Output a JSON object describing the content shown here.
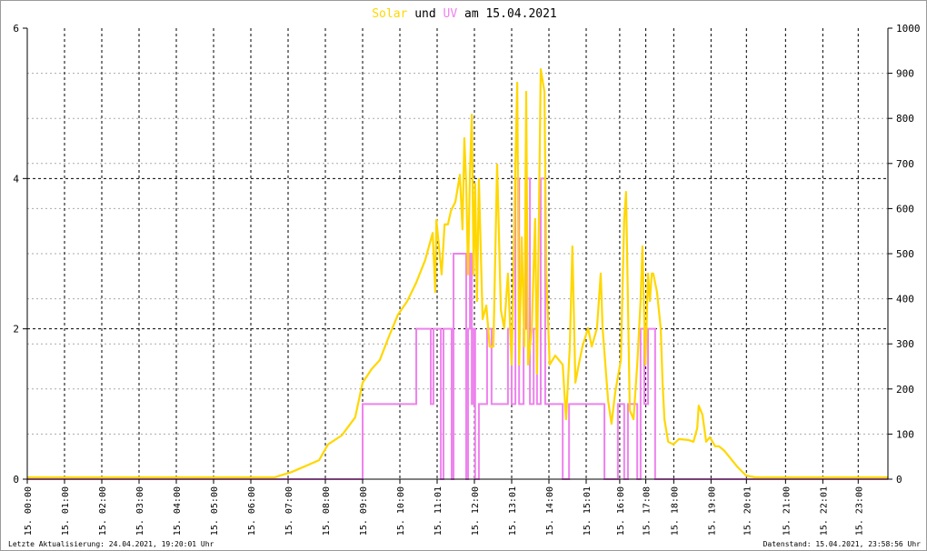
{
  "chart_data": {
    "type": "line",
    "title_parts": {
      "solar": "Solar",
      "und": "und",
      "uv": "UV",
      "date": "am 15.04.2021"
    },
    "left_axis": {
      "label": "UV",
      "ylim": [
        0,
        6
      ],
      "ticks": [
        "0",
        "2",
        "4",
        "6"
      ]
    },
    "right_axis": {
      "label": "Solar",
      "ylim": [
        0,
        1000
      ],
      "ticks": [
        "0",
        "100",
        "200",
        "300",
        "400",
        "500",
        "600",
        "700",
        "800",
        "900",
        "1000"
      ]
    },
    "x_ticks": [
      {
        "x": 0,
        "label": "15. 00:00"
      },
      {
        "x": 1,
        "label": "15. 01:00"
      },
      {
        "x": 2,
        "label": "15. 02:00"
      },
      {
        "x": 3,
        "label": "15. 03:00"
      },
      {
        "x": 4,
        "label": "15. 04:00"
      },
      {
        "x": 5,
        "label": "15. 05:00"
      },
      {
        "x": 6,
        "label": "15. 06:00"
      },
      {
        "x": 7,
        "label": "15. 07:00"
      },
      {
        "x": 8,
        "label": "15. 08:00"
      },
      {
        "x": 9,
        "label": "15. 09:00"
      },
      {
        "x": 10,
        "label": "15. 10:00"
      },
      {
        "x": 11,
        "label": "15. 11:01"
      },
      {
        "x": 12,
        "label": "15. 12:00"
      },
      {
        "x": 13,
        "label": "15. 13:01"
      },
      {
        "x": 14,
        "label": "15. 14:00"
      },
      {
        "x": 15,
        "label": "15. 15:01"
      },
      {
        "x": 15.9,
        "label": "15. 16:00"
      },
      {
        "x": 16.6,
        "label": "15. 17:08"
      },
      {
        "x": 17.35,
        "label": "15. 18:00"
      },
      {
        "x": 18.35,
        "label": "15. 19:00"
      },
      {
        "x": 19.3,
        "label": "15. 20:01"
      },
      {
        "x": 20.35,
        "label": "15. 21:00"
      },
      {
        "x": 21.35,
        "label": "15. 22:01"
      },
      {
        "x": 22.3,
        "label": "15. 23:00"
      }
    ],
    "xlim": [
      0,
      23.1
    ],
    "series": [
      {
        "name": "Solar",
        "axis": "right",
        "color": "#ffd700",
        "points": [
          [
            0,
            4
          ],
          [
            6.63,
            4
          ],
          [
            7.1,
            16
          ],
          [
            7.83,
            42
          ],
          [
            8.07,
            77
          ],
          [
            8.44,
            97
          ],
          [
            8.8,
            137
          ],
          [
            9.0,
            214
          ],
          [
            9.24,
            244
          ],
          [
            9.46,
            264
          ],
          [
            9.7,
            315
          ],
          [
            9.95,
            365
          ],
          [
            10.2,
            395
          ],
          [
            10.44,
            436
          ],
          [
            10.68,
            486
          ],
          [
            10.88,
            546
          ],
          [
            10.95,
            415
          ],
          [
            10.98,
            575
          ],
          [
            11.12,
            454
          ],
          [
            11.2,
            565
          ],
          [
            11.29,
            565
          ],
          [
            11.37,
            595
          ],
          [
            11.49,
            615
          ],
          [
            11.61,
            675
          ],
          [
            11.68,
            554
          ],
          [
            11.73,
            756
          ],
          [
            11.78,
            655
          ],
          [
            11.83,
            454
          ],
          [
            11.88,
            677
          ],
          [
            11.93,
            808
          ],
          [
            11.98,
            454
          ],
          [
            12.02,
            655
          ],
          [
            12.07,
            395
          ],
          [
            12.12,
            665
          ],
          [
            12.22,
            355
          ],
          [
            12.32,
            385
          ],
          [
            12.41,
            294
          ],
          [
            12.51,
            294
          ],
          [
            12.61,
            698
          ],
          [
            12.71,
            375
          ],
          [
            12.8,
            335
          ],
          [
            12.9,
            456
          ],
          [
            13.0,
            254
          ],
          [
            13.1,
            698
          ],
          [
            13.15,
            879
          ],
          [
            13.2,
            254
          ],
          [
            13.27,
            536
          ],
          [
            13.34,
            294
          ],
          [
            13.39,
            859
          ],
          [
            13.44,
            254
          ],
          [
            13.54,
            335
          ],
          [
            13.63,
            577
          ],
          [
            13.68,
            234
          ],
          [
            13.78,
            909
          ],
          [
            13.88,
            859
          ],
          [
            13.93,
            456
          ],
          [
            14.02,
            254
          ],
          [
            14.17,
            274
          ],
          [
            14.37,
            254
          ],
          [
            14.46,
            133
          ],
          [
            14.56,
            294
          ],
          [
            14.63,
            516
          ],
          [
            14.71,
            214
          ],
          [
            14.8,
            254
          ],
          [
            14.9,
            294
          ],
          [
            15.05,
            335
          ],
          [
            15.15,
            294
          ],
          [
            15.29,
            335
          ],
          [
            15.39,
            456
          ],
          [
            15.44,
            335
          ],
          [
            15.59,
            173
          ],
          [
            15.68,
            123
          ],
          [
            15.78,
            193
          ],
          [
            15.93,
            264
          ],
          [
            16.02,
            577
          ],
          [
            16.07,
            637
          ],
          [
            16.17,
            153
          ],
          [
            16.27,
            133
          ],
          [
            16.37,
            254
          ],
          [
            16.46,
            395
          ],
          [
            16.51,
            516
          ],
          [
            16.59,
            254
          ],
          [
            16.66,
            456
          ],
          [
            16.71,
            395
          ],
          [
            16.76,
            456
          ],
          [
            16.8,
            456
          ],
          [
            16.9,
            415
          ],
          [
            17.0,
            335
          ],
          [
            17.05,
            214
          ],
          [
            17.1,
            133
          ],
          [
            17.2,
            83
          ],
          [
            17.34,
            77
          ],
          [
            17.49,
            89
          ],
          [
            17.73,
            87
          ],
          [
            17.88,
            83
          ],
          [
            17.98,
            113
          ],
          [
            18.02,
            163
          ],
          [
            18.12,
            143
          ],
          [
            18.22,
            83
          ],
          [
            18.32,
            93
          ],
          [
            18.46,
            73
          ],
          [
            18.56,
            73
          ],
          [
            18.71,
            63
          ],
          [
            19.05,
            28
          ],
          [
            19.29,
            8
          ],
          [
            19.54,
            4
          ],
          [
            23.1,
            4
          ]
        ]
      },
      {
        "name": "UV",
        "axis": "left",
        "color": "#ee82ee",
        "steps": [
          [
            0,
            0
          ],
          [
            9.0,
            1
          ],
          [
            10.44,
            2
          ],
          [
            10.83,
            1
          ],
          [
            10.9,
            2
          ],
          [
            11.1,
            0
          ],
          [
            11.17,
            2
          ],
          [
            11.39,
            0
          ],
          [
            11.44,
            3
          ],
          [
            11.78,
            0
          ],
          [
            11.83,
            2
          ],
          [
            11.88,
            3
          ],
          [
            11.93,
            1
          ],
          [
            11.98,
            2
          ],
          [
            12.02,
            0
          ],
          [
            12.12,
            1
          ],
          [
            12.34,
            2
          ],
          [
            12.46,
            1
          ],
          [
            12.9,
            2
          ],
          [
            13.0,
            1
          ],
          [
            13.1,
            4
          ],
          [
            13.2,
            1
          ],
          [
            13.32,
            2
          ],
          [
            13.39,
            4
          ],
          [
            13.49,
            1
          ],
          [
            13.59,
            2
          ],
          [
            13.68,
            1
          ],
          [
            13.78,
            4
          ],
          [
            13.9,
            1
          ],
          [
            14.37,
            0
          ],
          [
            14.54,
            1
          ],
          [
            15.49,
            0
          ],
          [
            15.85,
            1
          ],
          [
            16.02,
            0
          ],
          [
            16.12,
            1
          ],
          [
            16.37,
            0
          ],
          [
            16.46,
            2
          ],
          [
            16.56,
            1
          ],
          [
            16.66,
            2
          ],
          [
            16.85,
            0
          ],
          [
            23.1,
            0
          ]
        ]
      }
    ]
  },
  "footer": {
    "last_update": "Letzte Aktualisierung: 24.04.2021, 19:20:01 Uhr",
    "data_state": "Datenstand: 15.04.2021, 23:58:56 Uhr"
  }
}
